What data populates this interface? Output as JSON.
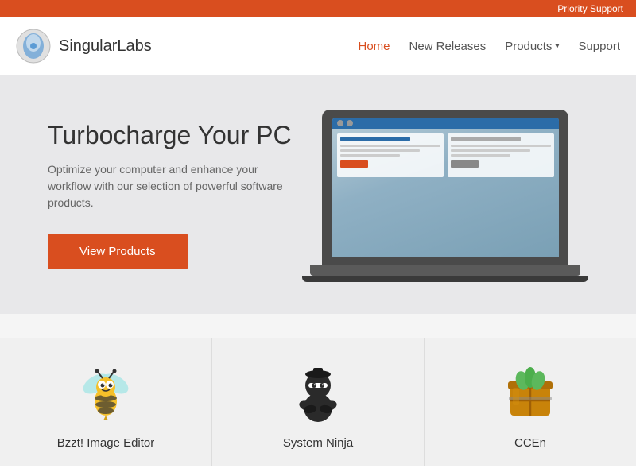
{
  "topbar": {
    "label": "Priority Support"
  },
  "header": {
    "logo_text": "SingularLabs",
    "nav": [
      {
        "id": "home",
        "label": "Home",
        "active": true,
        "dropdown": false
      },
      {
        "id": "new-releases",
        "label": "New Releases",
        "active": false,
        "dropdown": false
      },
      {
        "id": "products",
        "label": "Products",
        "active": false,
        "dropdown": true
      },
      {
        "id": "support",
        "label": "Support",
        "active": false,
        "dropdown": false
      }
    ]
  },
  "hero": {
    "title": "Turbocharge Your PC",
    "subtitle": "Optimize your computer and enhance your workflow with our selection of powerful software products.",
    "cta_label": "View Products"
  },
  "products": [
    {
      "id": "bzzt",
      "name": "Bzzt! Image Editor"
    },
    {
      "id": "system-ninja",
      "name": "System Ninja"
    },
    {
      "id": "ccen",
      "name": "CCEn"
    }
  ]
}
